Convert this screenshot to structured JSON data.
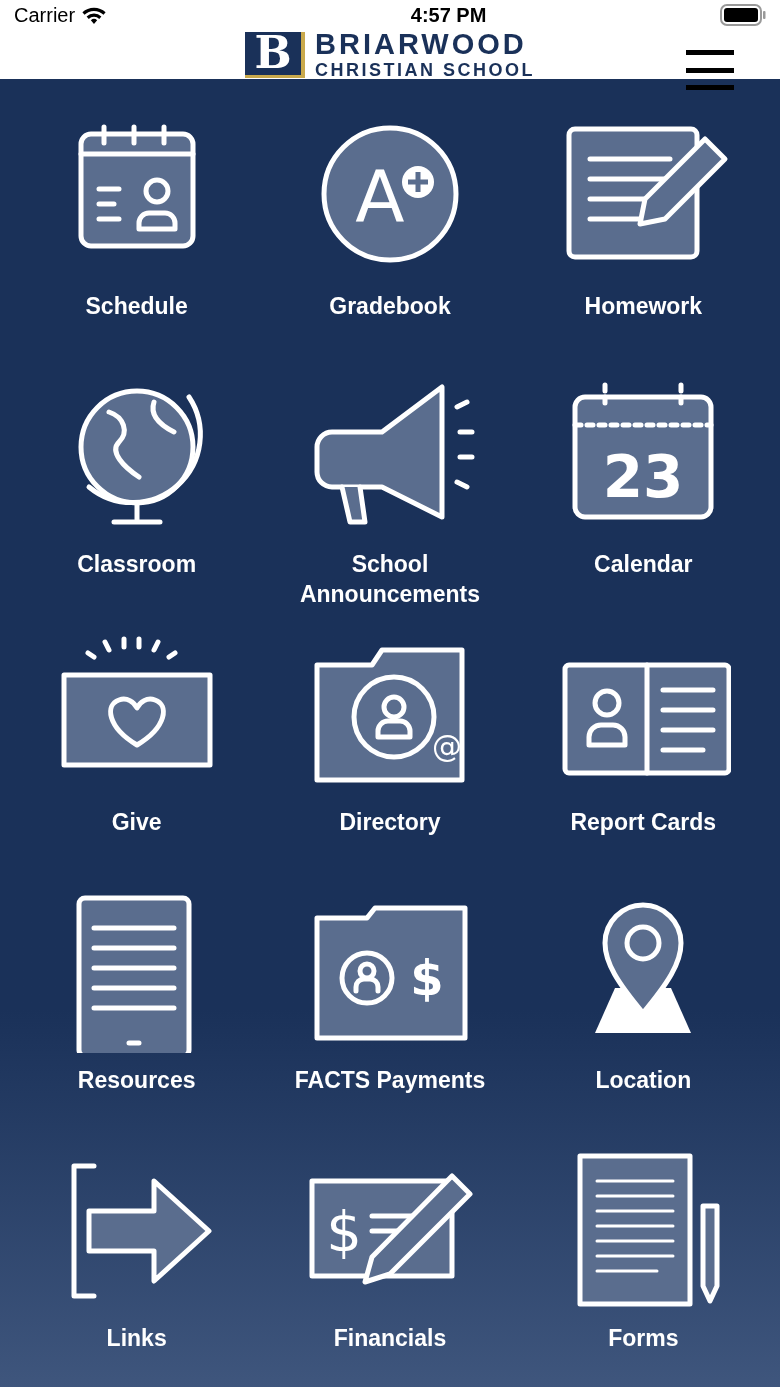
{
  "status_bar": {
    "carrier": "Carrier",
    "time": "4:57 PM"
  },
  "header": {
    "logo_letter": "B",
    "logo_title": "BRIARWOOD",
    "logo_subtitle": "CHRISTIAN SCHOOL"
  },
  "tiles": [
    {
      "kind": "schedule",
      "label": "Schedule"
    },
    {
      "kind": "gradebook",
      "label": "Gradebook",
      "icon_text": "A"
    },
    {
      "kind": "homework",
      "label": "Homework"
    },
    {
      "kind": "classroom",
      "label": "Classroom"
    },
    {
      "kind": "announcements",
      "label": "School Announcements"
    },
    {
      "kind": "calendar",
      "label": "Calendar",
      "icon_text": "23"
    },
    {
      "kind": "give",
      "label": "Give"
    },
    {
      "kind": "directory",
      "label": "Directory",
      "icon_text": "@"
    },
    {
      "kind": "reportcards",
      "label": "Report Cards"
    },
    {
      "kind": "resources",
      "label": "Resources"
    },
    {
      "kind": "payments",
      "label": "FACTS Payments",
      "icon_text": "$"
    },
    {
      "kind": "location",
      "label": "Location"
    },
    {
      "kind": "links",
      "label": "Links"
    },
    {
      "kind": "financials",
      "label": "Financials",
      "icon_text": "$"
    },
    {
      "kind": "forms",
      "label": "Forms"
    }
  ]
}
